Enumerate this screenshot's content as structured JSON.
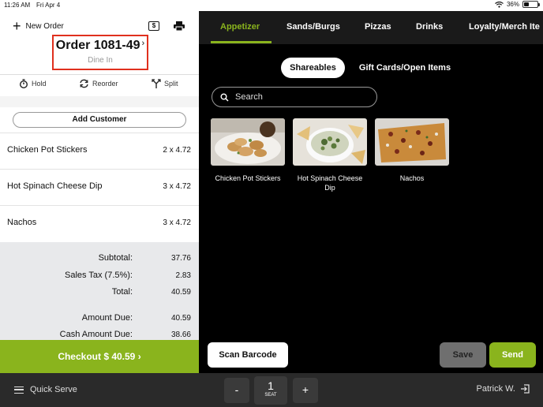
{
  "status_bar": {
    "time": "11:26 AM",
    "date": "Fri Apr 4",
    "battery": "36%",
    "battery_level": 0.36
  },
  "order_panel": {
    "new_order_label": "New Order",
    "order_title": "Order 1081-49",
    "order_type": "Dine In",
    "actions": {
      "hold": "Hold",
      "reorder": "Reorder",
      "split": "Split"
    },
    "add_customer_label": "Add Customer",
    "items": [
      {
        "name": "Chicken Pot Stickers",
        "qty": "2 x 4.72"
      },
      {
        "name": "Hot Spinach Cheese Dip",
        "qty": "3 x 4.72"
      },
      {
        "name": "Nachos",
        "qty": "3 x 4.72"
      }
    ],
    "totals": {
      "subtotal_label": "Subtotal:",
      "subtotal": "37.76",
      "tax_label": "Sales Tax (7.5%):",
      "tax": "2.83",
      "total_label": "Total:",
      "total": "40.59",
      "amount_due_label": "Amount Due:",
      "amount_due": "40.59",
      "cash_label": "Cash Amount Due:",
      "cash": "38.66"
    },
    "checkout_label": "Checkout $ 40.59  ›"
  },
  "menu": {
    "categories": [
      "Appetizer",
      "Sands/Burgs",
      "Pizzas",
      "Drinks",
      "Loyalty/Merch Ite"
    ],
    "active_category": "Appetizer",
    "subtabs": [
      "Shareables",
      "Gift Cards/Open Items"
    ],
    "search_placeholder": "Search",
    "products": [
      {
        "label": "Chicken Pot Stickers"
      },
      {
        "label": "Hot Spinach Cheese Dip"
      },
      {
        "label": "Nachos"
      }
    ],
    "scan_label": "Scan Barcode",
    "save_label": "Save",
    "send_label": "Send"
  },
  "bottom_bar": {
    "mode_label": "Quick Serve",
    "minus_label": "-",
    "seat_number": "1",
    "seat_label": "SEAT",
    "plus_label": "+",
    "user_name": "Patrick W."
  },
  "colors": {
    "accent": "#8ab41d",
    "highlight_border": "#e0301e",
    "dark_bg": "#000000"
  }
}
